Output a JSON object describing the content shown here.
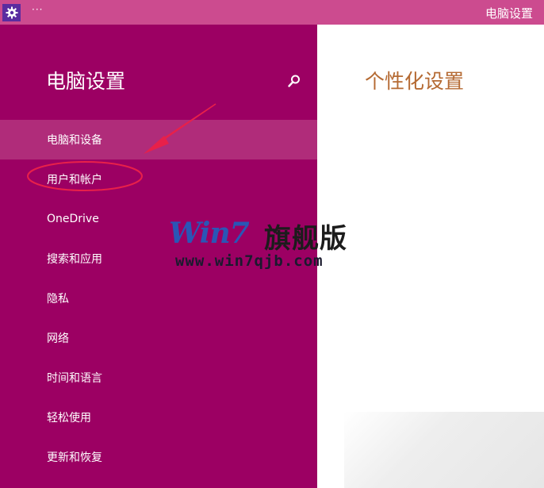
{
  "titlebar": {
    "app_icon": "gear-icon",
    "dots": "···",
    "title": "电脑设置"
  },
  "sidebar": {
    "heading": "电脑设置",
    "search_icon": "search-icon",
    "items": [
      {
        "label": "电脑和设备",
        "selected": true
      },
      {
        "label": "用户和帐户",
        "selected": false
      },
      {
        "label": "OneDrive",
        "selected": false
      },
      {
        "label": "搜索和应用",
        "selected": false
      },
      {
        "label": "隐私",
        "selected": false
      },
      {
        "label": "网络",
        "selected": false
      },
      {
        "label": "时间和语言",
        "selected": false
      },
      {
        "label": "轻松使用",
        "selected": false
      },
      {
        "label": "更新和恢复",
        "selected": false
      }
    ]
  },
  "main": {
    "heading": "个性化设置"
  },
  "watermark": {
    "brand": "Win7",
    "brand_cn": "旗舰版",
    "url": "www.win7qjb.com"
  },
  "colors": {
    "titlebar": "#cc4b8f",
    "sidebar": "#9c0063",
    "selected_item": "#b02c7a",
    "heading_accent": "#b56a33",
    "annotation": "#e8204a"
  }
}
